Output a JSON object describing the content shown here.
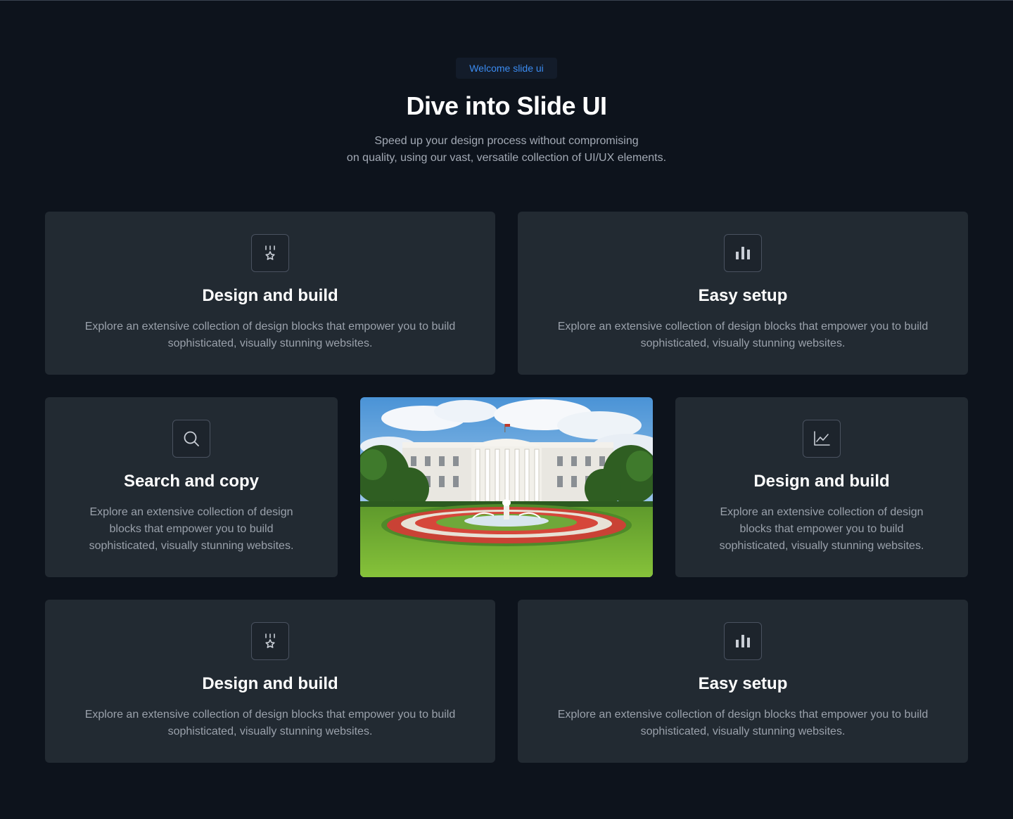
{
  "hero": {
    "badge": "Welcome slide ui",
    "title": "Dive into Slide UI",
    "subtitle_line1": "Speed up your design process without compromising",
    "subtitle_line2": "on quality, using our vast, versatile collection of UI/UX elements."
  },
  "cards": [
    {
      "icon": "medal-star-icon",
      "title": "Design and build",
      "desc_line1": "Explore an extensive collection of design blocks that empower you to build",
      "desc_line2": "sophisticated, visually stunning websites."
    },
    {
      "icon": "bar-chart-icon",
      "title": "Easy setup",
      "desc_line1": "Explore an extensive collection of design blocks that empower you to build",
      "desc_line2": "sophisticated, visually stunning websites."
    },
    {
      "icon": "search-icon",
      "title": "Search and copy",
      "desc_line1": "Explore an extensive collection of design",
      "desc_line2": "blocks that empower you to build",
      "desc_line3": "sophisticated, visually stunning websites."
    },
    {
      "icon": "line-chart-icon",
      "title": "Design and build",
      "desc_line1": "Explore an extensive collection of design",
      "desc_line2": "blocks that empower you to build",
      "desc_line3": "sophisticated, visually stunning websites."
    },
    {
      "icon": "medal-star-icon",
      "title": "Design and build",
      "desc_line1": "Explore an extensive collection of design blocks that empower you to build",
      "desc_line2": "sophisticated, visually stunning websites."
    },
    {
      "icon": "bar-chart-icon",
      "title": "Easy setup",
      "desc_line1": "Explore an extensive collection of design blocks that empower you to build",
      "desc_line2": "sophisticated, visually stunning websites."
    }
  ],
  "photo": {
    "subject": "white-house-garden-image"
  },
  "colors": {
    "background": "#0d131c",
    "card": "#222a32",
    "accent": "#3b8bf0",
    "muted_text": "#9aa1ab"
  }
}
